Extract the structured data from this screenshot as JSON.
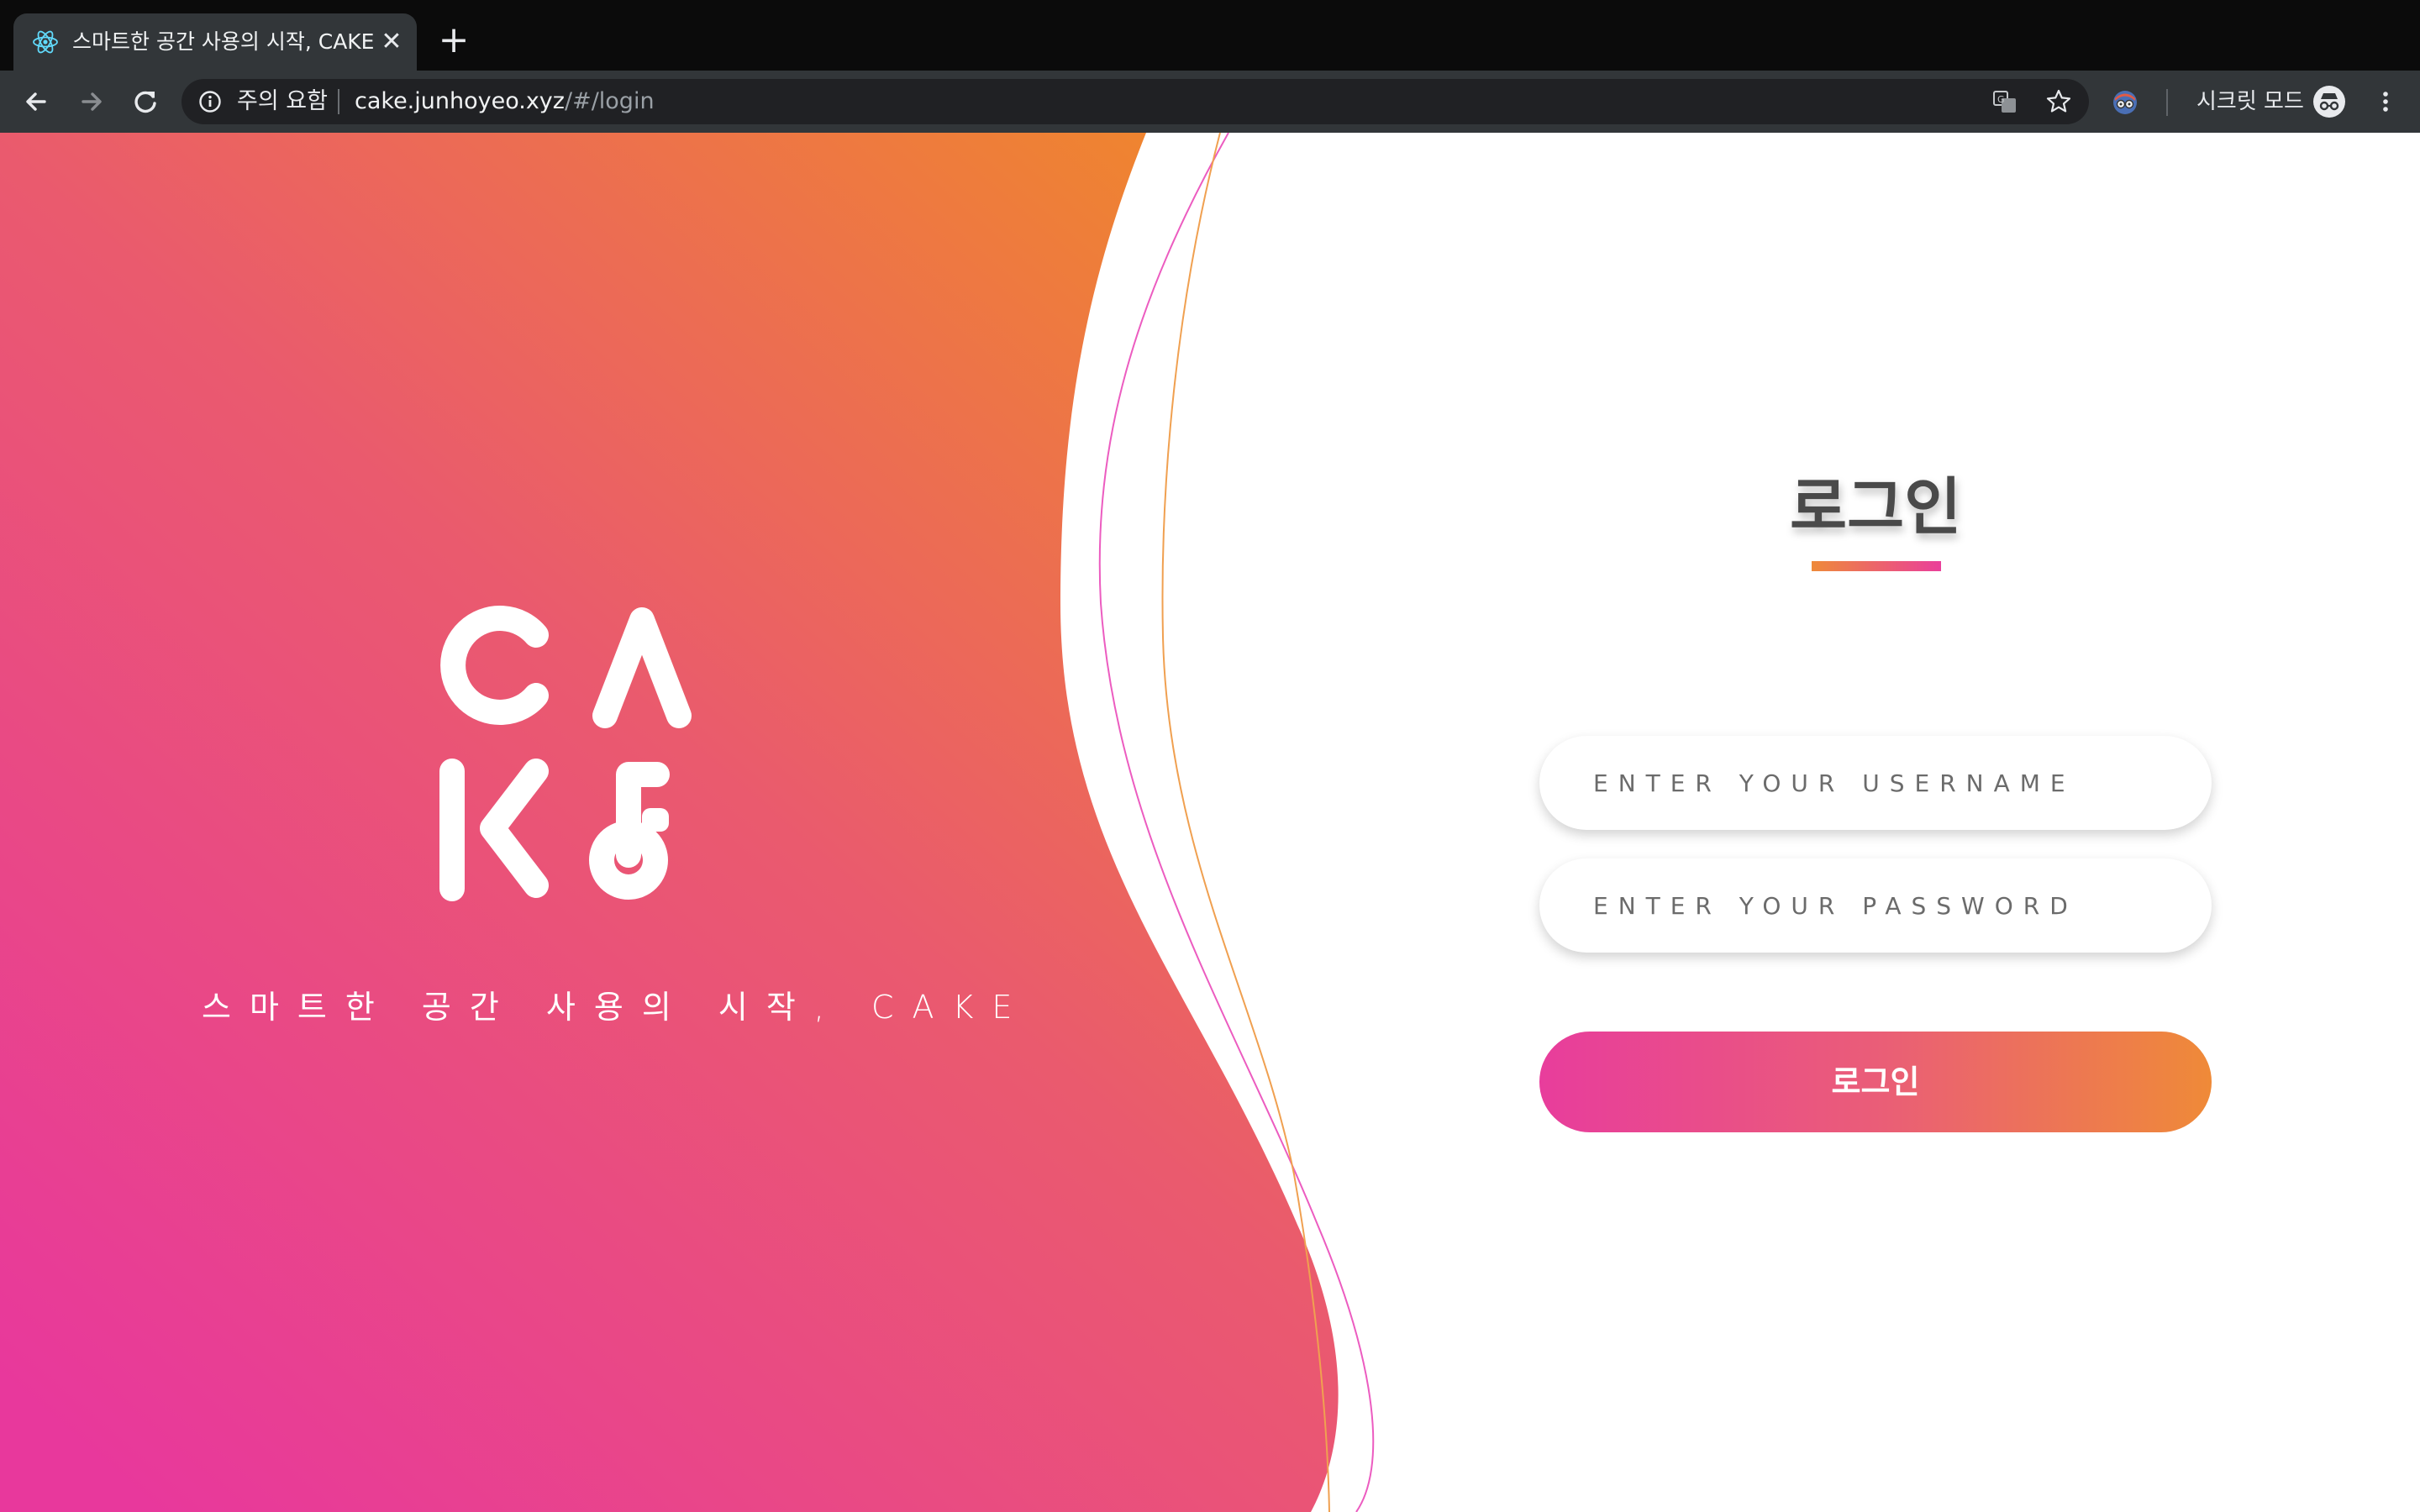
{
  "browser": {
    "tab": {
      "title": "스마트한 공간 사용의 시작, CAKE",
      "favicon": "react-atom-icon"
    },
    "new_tab_symbol": "+",
    "close_symbol": "✕",
    "omnibox": {
      "security_label": "주의 요함",
      "url_host": "cake.junhoyeo.xyz",
      "url_path": "/#/login"
    },
    "incognito_label": "시크릿 모드",
    "icons": [
      "back-icon",
      "forward-icon",
      "reload-icon",
      "info-icon",
      "translate-icon",
      "star-icon",
      "extension-icon",
      "incognito-icon",
      "menu-icon"
    ]
  },
  "hero": {
    "logo": "CAKE",
    "tagline": "스마트한 공간 사용의 시작, CAKE",
    "colors": {
      "gradient_pink": "#e8389c",
      "gradient_coral": "#ea5a6e",
      "gradient_orange": "#ef8430",
      "line_pink": "#ec5cc0",
      "line_orange": "#f0a050"
    }
  },
  "login": {
    "title": "로그인",
    "username_placeholder": "ENTER YOUR USERNAME",
    "password_placeholder": "ENTER YOUR PASSWORD",
    "submit_label": "로그인"
  }
}
